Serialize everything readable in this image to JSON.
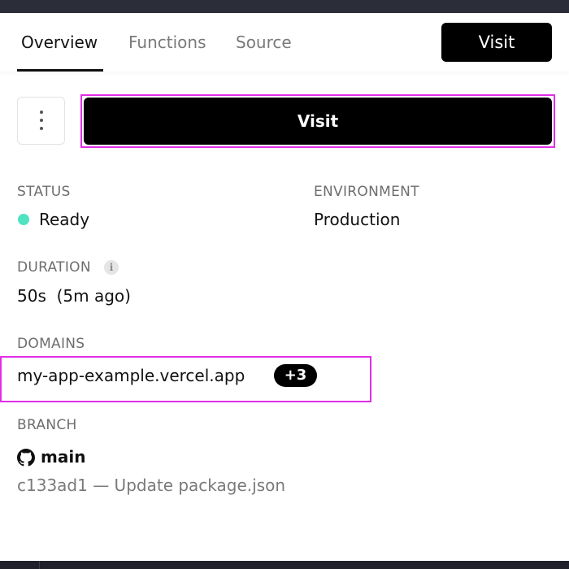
{
  "nav": {
    "tabs": [
      {
        "label": "Overview",
        "active": true
      },
      {
        "label": "Functions",
        "active": false
      },
      {
        "label": "Source",
        "active": false
      }
    ],
    "visit_label": "Visit"
  },
  "actions": {
    "more_icon": "more-vertical-icon",
    "visit_label": "Visit"
  },
  "status": {
    "label": "STATUS",
    "value": "Ready",
    "color": "#50e3c2"
  },
  "environment": {
    "label": "ENVIRONMENT",
    "value": "Production"
  },
  "duration": {
    "label": "DURATION",
    "info_icon": "info-icon",
    "value": "50s  (5m ago)"
  },
  "domains": {
    "label": "DOMAINS",
    "primary": "my-app-example.vercel.app",
    "more_count": "+3"
  },
  "branch": {
    "label": "BRANCH",
    "icon": "github-icon",
    "name": "main",
    "commit": "c133ad1 — Update package.json"
  },
  "colors": {
    "highlight": "#e12fe6",
    "primary": "#000000",
    "status_ready": "#50e3c2"
  }
}
